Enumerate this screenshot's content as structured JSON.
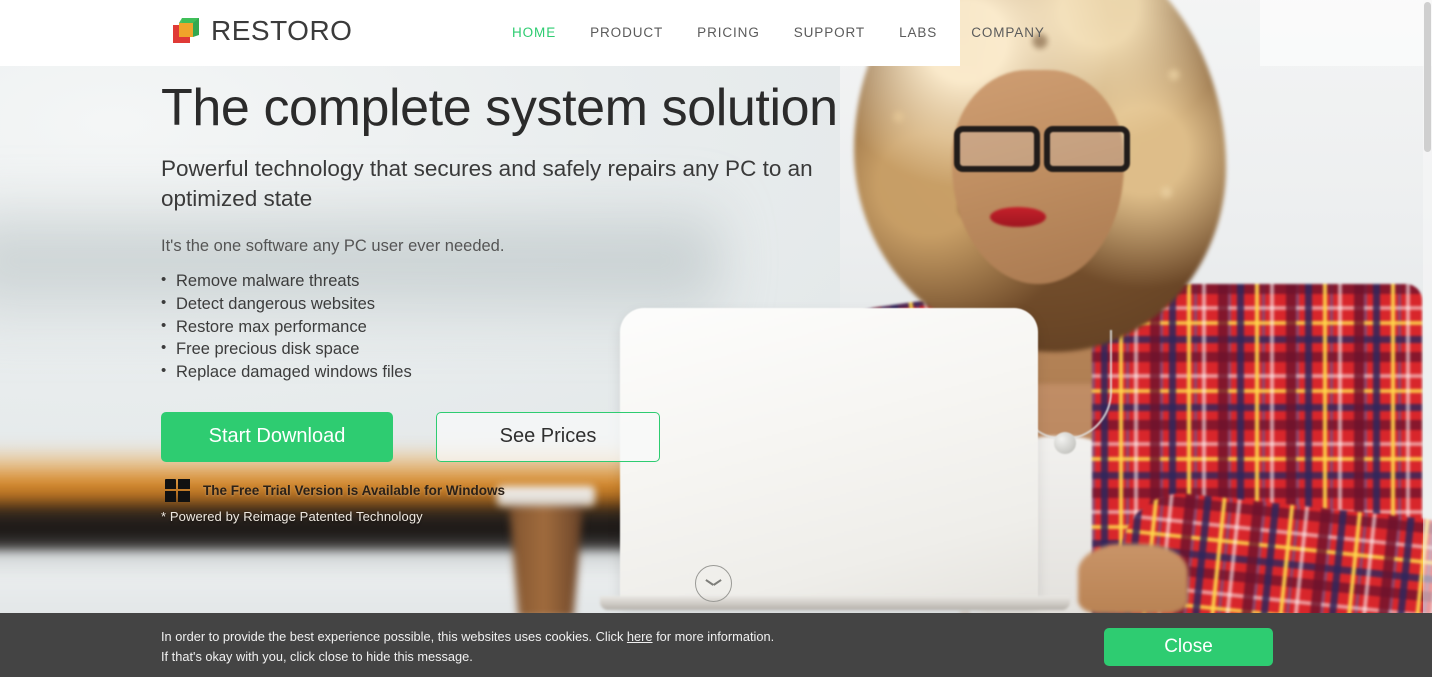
{
  "brand": {
    "name": "RESTORO",
    "logo_icon": "cube-logo-icon",
    "logo_colors": {
      "green": "#3fbf5a",
      "red": "#e03a36",
      "orange": "#f0a52a"
    }
  },
  "nav": {
    "items": [
      {
        "label": "HOME",
        "active": true
      },
      {
        "label": "PRODUCT",
        "active": false
      },
      {
        "label": "PRICING",
        "active": false
      },
      {
        "label": "SUPPORT",
        "active": false
      },
      {
        "label": "LABS",
        "active": false
      },
      {
        "label": "COMPANY",
        "active": false
      }
    ]
  },
  "hero": {
    "title": "The complete system solution",
    "subtitle": "Powerful technology that secures and safely repairs any PC to an optimized state",
    "lead": "It's the one software any PC user ever needed.",
    "features": [
      "Remove malware threats",
      "Detect dangerous websites",
      "Restore max performance",
      "Free precious disk space",
      "Replace damaged windows files"
    ],
    "primary_cta": "Start Download",
    "secondary_cta": "See Prices",
    "trial_note": "The Free Trial Version is Available for Windows",
    "trial_icon": "windows-logo-icon",
    "powered_note": "* Powered by Reimage Patented Technology",
    "scroll_icon": "chevron-down-icon"
  },
  "cookie": {
    "line1_a": "In order to provide the best experience possible, this websites uses cookies. Click ",
    "link": "here",
    "line1_b": " for more information.",
    "line2": "If that's okay with you, click close to hide this message.",
    "close_label": "Close"
  },
  "colors": {
    "accent_green": "#2ecc71",
    "cookie_bar": "#444444",
    "heading": "#2b2b2b",
    "body_text": "#3c3c3c"
  }
}
